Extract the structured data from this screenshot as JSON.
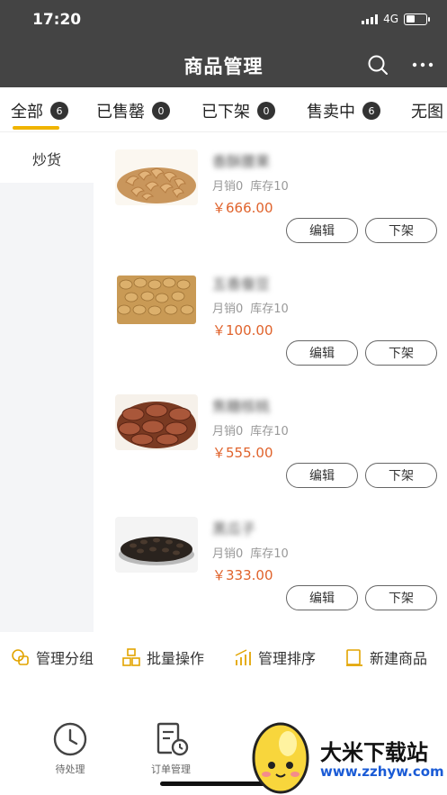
{
  "status_bar": {
    "time": "17:20",
    "network": "4G"
  },
  "nav": {
    "title": "商品管理",
    "search_icon": "search-icon",
    "more_icon": "more-icon"
  },
  "tabs": [
    {
      "label": "全部",
      "count": "6",
      "active": true
    },
    {
      "label": "已售罄",
      "count": "0"
    },
    {
      "label": "已下架",
      "count": "0"
    },
    {
      "label": "售卖中",
      "count": "6"
    },
    {
      "label": "无图"
    }
  ],
  "categories": [
    {
      "label": "炒货",
      "active": true
    }
  ],
  "products": [
    {
      "name": "香酥腰果",
      "monthly_sales": "月销0",
      "stock": "库存10",
      "price": "￥666.00",
      "edit_label": "编辑",
      "off_label": "下架"
    },
    {
      "name": "五香蚕豆",
      "monthly_sales": "月销0",
      "stock": "库存10",
      "price": "￥100.00",
      "edit_label": "编辑",
      "off_label": "下架"
    },
    {
      "name": "焦糖核桃",
      "monthly_sales": "月销0",
      "stock": "库存10",
      "price": "￥555.00",
      "edit_label": "编辑",
      "off_label": "下架"
    },
    {
      "name": "黑瓜子",
      "monthly_sales": "月销0",
      "stock": "库存10",
      "price": "￥333.00",
      "edit_label": "编辑",
      "off_label": "下架"
    }
  ],
  "actions": [
    {
      "label": "管理分组",
      "icon": "group-icon"
    },
    {
      "label": "批量操作",
      "icon": "batch-icon"
    },
    {
      "label": "管理排序",
      "icon": "sort-icon"
    },
    {
      "label": "新建商品",
      "icon": "new-product-icon"
    }
  ],
  "bottom_nav": [
    {
      "label": "待处理",
      "icon": "clock-icon"
    },
    {
      "label": "订单管理",
      "icon": "order-icon"
    }
  ],
  "watermark": {
    "title": "大米下载站",
    "url": "www.zzhyw.com"
  },
  "colors": {
    "header": "#444444",
    "accent": "#f0b400",
    "price": "#e0632c"
  }
}
